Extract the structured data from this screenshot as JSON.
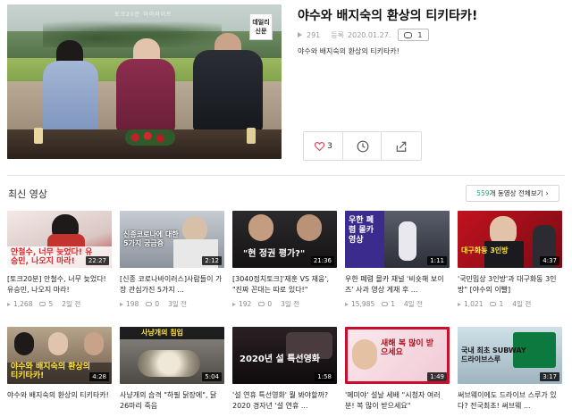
{
  "featured": {
    "title": "야수와 배지숙의 환상의 티키타카!",
    "views": "291",
    "date_label": "등록",
    "date": "2020.01.27.",
    "comments": "1",
    "description": "야수와 배지숙의 환상의 티키타카!",
    "likes": "3",
    "thumb_watermark": "토크20분 하이라이트",
    "thumb_logo": "데일리 신문"
  },
  "recent": {
    "title": "최신 영상",
    "total_count": "559",
    "view_all_label": "개 동영상 전체보기",
    "videos": [
      {
        "title": "[토크20분] 안철수, 너무 늦었다! 유승민, 나오지 마라!",
        "duration": "22:27",
        "views": "1,268",
        "comments": "5",
        "date": "2일 전",
        "thumb_caption": "안철수, 너무 늦었다! 유승민, 나오지 마라!"
      },
      {
        "title": "[신종 코로나바이러스]사람들이 가장 관심가진 5가지 ...",
        "duration": "2:12",
        "views": "198",
        "comments": "0",
        "date": "3일 전",
        "thumb_caption": "신종코로나에 대한 5가지 궁금증"
      },
      {
        "title": "[3040정치토크]'재훈 VS 재웅', \"진짜 꼰대는 따로 있다!\"",
        "duration": "21:36",
        "views": "192",
        "comments": "0",
        "date": "3일 전",
        "thumb_caption": "\"현 정권 평가?\""
      },
      {
        "title": "우한 폐렴 몰카 채널 '비숏해 보이즈' 사과 영상 게재 후 ...",
        "duration": "1:11",
        "views": "15,985",
        "comments": "1",
        "date": "4일 전",
        "thumb_caption": "우한 폐렴 몰카 영상"
      },
      {
        "title": "'국민밉상 3인방'과 대구화동 3인방\" [야수의 이빨]",
        "duration": "4:37",
        "views": "1,021",
        "comments": "1",
        "date": "4일 전",
        "thumb_caption": "대구화동 3인방"
      },
      {
        "title": "야수와 배지숙의 환상의 티키타카!",
        "duration": "4:28",
        "views": "",
        "comments": "",
        "date": "",
        "thumb_caption": "야수와 배지숙의 환상의 티키타카!"
      },
      {
        "title": "사냥개의 습격 \"하필 닭장에\", 닭 26마리 죽음",
        "duration": "5:04",
        "views": "",
        "comments": "",
        "date": "",
        "thumb_caption": "사냥개의 침입"
      },
      {
        "title": "'설 연휴 특선영화' 뭘 봐야할까? 2020 경자년 '설 연휴 ...",
        "duration": "1:58",
        "views": "",
        "comments": "",
        "date": "",
        "thumb_caption": "2020년 설 특선영화"
      },
      {
        "title": "'메미야' 설날 세배 \"시청자 여러분! 복 많이 받으세요\"",
        "duration": "1:49",
        "views": "",
        "comments": "",
        "date": "",
        "thumb_caption": "새해 복 많이 받으세요"
      },
      {
        "title": "써브웨이에도 드라이브 스루가 있다? 전국최초! 써브웨 ...",
        "duration": "3:17",
        "views": "",
        "comments": "",
        "date": "",
        "thumb_caption": "국내 최초 SUBWAY 드라이브스루"
      }
    ]
  },
  "colors": {
    "accent": "#27a384",
    "like_heart": "#e0405a",
    "caption_yellow": "#ffe13a",
    "caption_red": "#d8262b"
  },
  "icons": {
    "views": "play-icon",
    "comments": "comment-icon",
    "like": "heart-icon",
    "later": "clock-icon",
    "share": "share-icon",
    "view_all": "chevron-right-icon"
  }
}
